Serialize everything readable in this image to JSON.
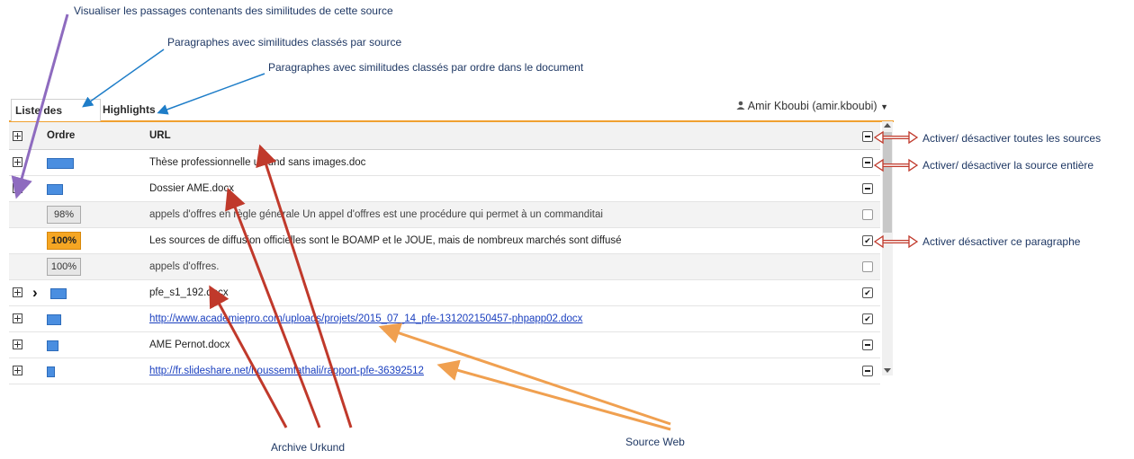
{
  "annotations": {
    "visualiser": "Visualiser les passages contenants des similitudes de cette source",
    "par_source": "Paragraphes avec similitudes classés par source",
    "par_ordre": "Paragraphes avec similitudes classés par ordre dans le document",
    "toutes_sources": "Activer/ désactiver toutes les sources",
    "source_entiere": "Activer/ désactiver la source entière",
    "paragraphe": "Activer désactiver ce paragraphe",
    "archive": "Archive Urkund",
    "web": "Source Web"
  },
  "tabs": [
    "Liste des sources",
    "Highlights"
  ],
  "user": "Amir Kboubi (amir.kboubi)",
  "columns": {
    "order": "Ordre",
    "url": "URL"
  },
  "rows": [
    {
      "kind": "source",
      "text": "Thèse professionnelle urkund sans images.doc",
      "bar": 0.78,
      "check": "minus"
    },
    {
      "kind": "source",
      "text": "Dossier AME.docx",
      "bar": 0.45,
      "check": "minus",
      "expanded": true
    },
    {
      "kind": "para",
      "pct": "98%",
      "text": "appels d'offres en règle générale Un appel d'offres est une procédure qui permet à un commanditai",
      "check": "unchecked"
    },
    {
      "kind": "para",
      "pct": "100%",
      "text": "Les sources de diffusion officielles sont le BOAMP et le JOUE, mais de nombreux marchés sont diffusé",
      "check": "checked",
      "hot": true
    },
    {
      "kind": "para",
      "pct": "100%",
      "text": "appels d'offres.",
      "check": "unchecked"
    },
    {
      "kind": "source",
      "text": "pfe_s1_192.docx",
      "bar": 0.45,
      "check": "checked",
      "chevron": true
    },
    {
      "kind": "source",
      "text": "http://www.academiepro.com/uploads/projets/2015_07_14_pfe-131202150457-phpapp02.docx",
      "bar": 0.38,
      "check": "checked",
      "link": true
    },
    {
      "kind": "source",
      "text": "AME Pernot.docx",
      "bar": 0.3,
      "check": "minus"
    },
    {
      "kind": "source",
      "text": "http://fr.slideshare.net/houssemfathali/rapport-pfe-36392512",
      "bar": 0.2,
      "check": "minus",
      "link": true
    }
  ],
  "colors": {
    "accent": "#f0a030",
    "annotation_arrow_red": "#c0392b",
    "annotation_arrow_orange": "#f0a050",
    "annotation_arrow_purple": "#8e6bbf",
    "annotation_arrow_blue": "#1e7dc8"
  }
}
